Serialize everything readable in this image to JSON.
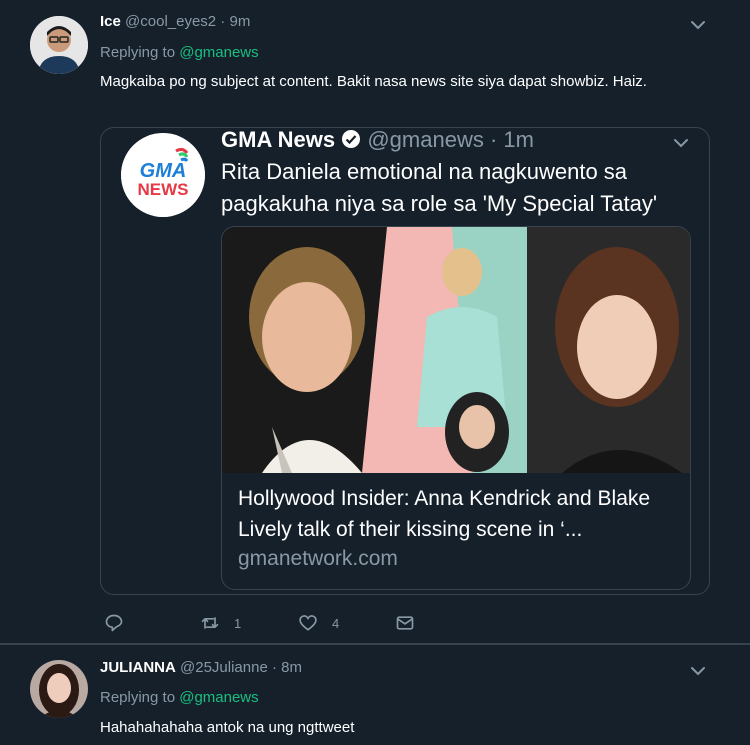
{
  "tweet1": {
    "name": "Ice",
    "handle": "@cool_eyes2 · 9m",
    "replying_prefix": "Replying to ",
    "replying_to": "@gmanews",
    "text": "Magkaiba po ng subject at content. Bakit nasa news site siya dapat showbiz. Haiz.",
    "quote": {
      "name": "GMA News",
      "handle": "@gmanews · 1m",
      "logo_text_top": "GMA",
      "logo_text_bottom": "NEWS",
      "text": "Rita Daniela emotional na nagkuwento sa pagkakuha niya sa role sa 'My Special Tatay'",
      "card": {
        "title": "Hollywood Insider: Anna Kendrick and Blake Lively talk of their kissing scene in ‘...",
        "domain": "gmanetwork.com"
      }
    },
    "actions": {
      "reply_icon": "reply-icon",
      "retweet_count": "1",
      "like_count": "4",
      "dm_icon": "envelope-icon"
    }
  },
  "tweet2": {
    "name": "JULIANNA",
    "handle": "@25Julianne · 8m",
    "replying_prefix": "Replying to ",
    "replying_to": "@gmanews",
    "text": "Hahahahahaha antok na ung ngttweet"
  },
  "colors": {
    "background": "#15202b",
    "border": "#38444d",
    "muted": "#8899a6",
    "mention": "#19bf80"
  }
}
